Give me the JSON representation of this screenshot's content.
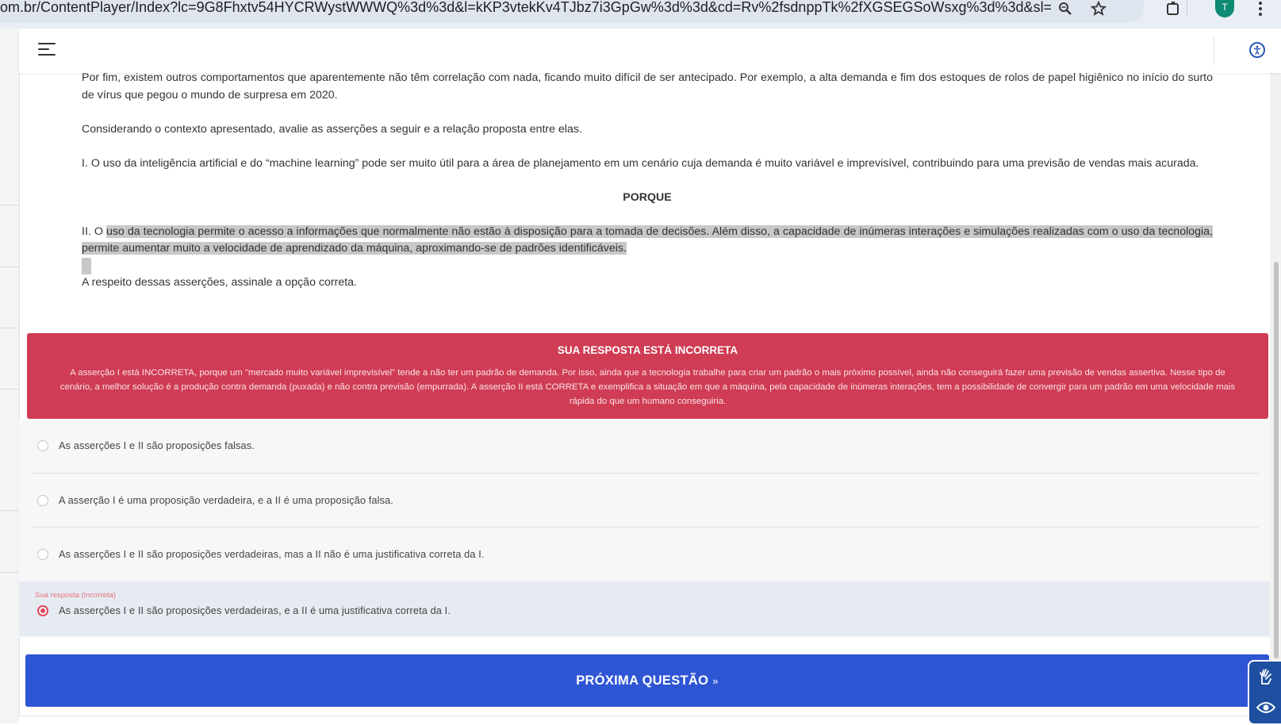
{
  "browser": {
    "url": "om.br/ContentPlayer/Index?lc=9G8Fhxtv54HYCRWystWWWQ%3d%3d&l=kKP3vtekKv4TJbz7i3GpGw%3d%3d&cd=Rv%2fsdnppTk%2fXGSEGSoWsxg%3d%3d&sl=PYHOiWbM...",
    "avatar_letter": "T",
    "icons": [
      "zoom-icon",
      "star-icon",
      "extensions-icon",
      "more-icon"
    ]
  },
  "header": {
    "menu_icon": "hamburger-menu-icon",
    "accessibility_icon": "accessibility-icon"
  },
  "question": {
    "p1": "Por fim, existem outros comportamentos que aparentemente não têm correlação com nada, ficando muito difícil de ser antecipado. Por exemplo, a alta demanda e fim dos estoques de rolos de papel higiênico no início do surto de vírus que pegou o mundo de surpresa em 2020.",
    "p2": "Considerando o contexto apresentado, avalie as asserções a seguir e a relação proposta entre elas.",
    "p3": "I. O uso da inteligência artificial e do “machine learning” pode ser muito útil para a área de planejamento em um cenário cuja demanda é muito variável e imprevisível, contribuindo para uma previsão de vendas mais acurada.",
    "porque": "PORQUE",
    "p4_prefix": "II. O ",
    "p4_highlight": "uso da tecnologia permite o acesso a informações que normalmente não estão à disposição para a tomada de decisões. Além disso, a capacidade de inúmeras interações e simulações realizadas com o uso da tecnologia, permite aumentar muito a velocidade de aprendizado da máquina, aproximando-se de padrões identificáveis.",
    "p5": "A respeito dessas asserções, assinale a opção correta."
  },
  "feedback": {
    "title": "SUA RESPOSTA ESTÁ INCORRETA",
    "text": "A asserção I está INCORRETA, porque um \"mercado muito variável imprevisível\" tende a não ter um padrão de demanda. Por isso, ainda que a tecnologia trabalhe para criar um padrão o mais próximo possível, ainda não conseguirá fazer uma previsão de vendas assertiva. Nesse tipo de cenário, a melhor solução é a produção contra demanda (puxada) e não contra previsão (empurrada). A asserção II está CORRETA e exemplifica a situação em que a máquina, pela capacidade de inúmeras interações, tem a possibilidade de convergir para um padrão em uma velocidade mais rápida do que um humano conseguiria.",
    "color": "#cf3c54"
  },
  "options": [
    {
      "label": "As asserções I e II são proposições falsas.",
      "selected": false
    },
    {
      "label": "A asserção I é uma proposição verdadeira, e a II é uma proposição falsa.",
      "selected": false
    },
    {
      "label": "As asserções I e II são proposições verdadeiras, mas a II não é uma justificativa correta da I.",
      "selected": false
    },
    {
      "label": "As asserções I e II são proposições verdadeiras, e a II é uma justificativa correta da I.",
      "selected": true,
      "note": "Sua resposta (incorreta)"
    }
  ],
  "next_button": {
    "label": "PRÓXIMA QUESTÃO",
    "icon": "double-chevron-right-icon",
    "color": "#2e55d4"
  },
  "widgets": [
    "sign-language-icon",
    "eye-icon"
  ]
}
